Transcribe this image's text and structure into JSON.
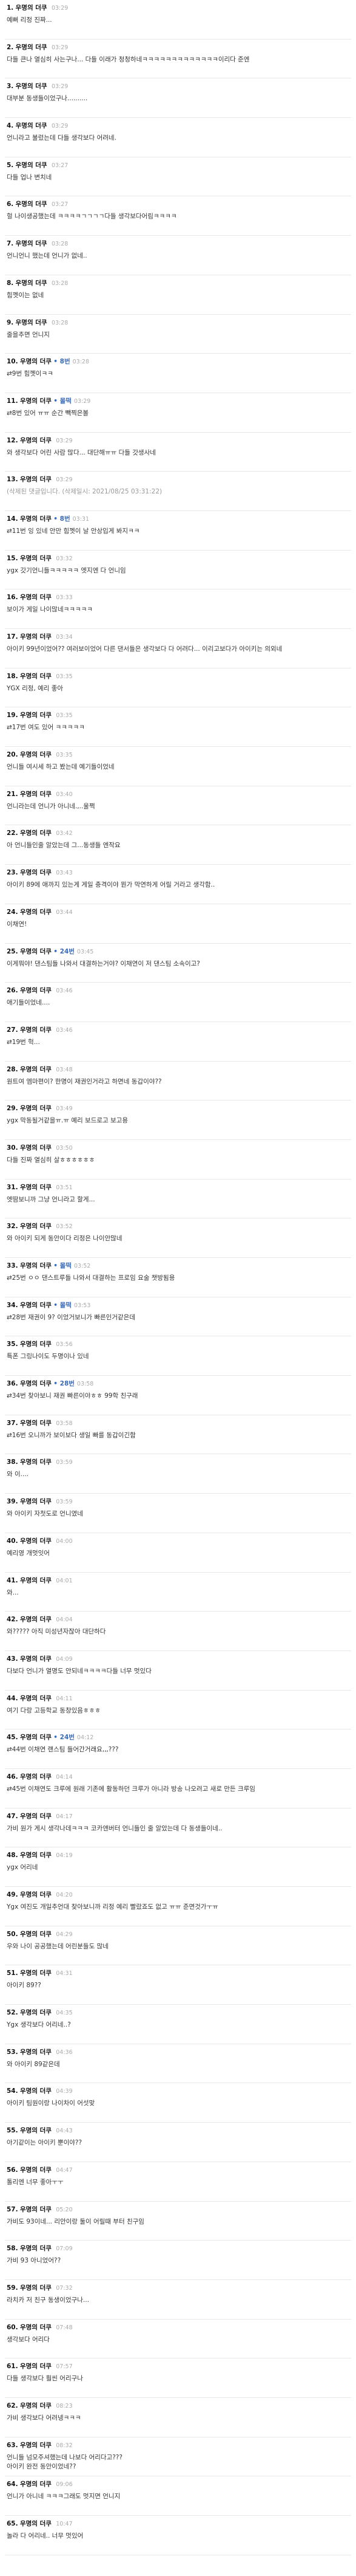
{
  "comments": [
    {
      "num": "1.",
      "nick": "우명의 더쿠",
      "mark": "",
      "time": "03:29",
      "ref": "",
      "text": "예뻐 리정 진짜..."
    },
    {
      "num": "2.",
      "nick": "우명의 더쿠",
      "mark": "",
      "time": "03:29",
      "ref": "",
      "text": "다들 큰나 열심히 사는구나... 다들 이래가 청청하네ㅋㅋㅋㅋㅋㅋㅋㅋㅋㅋㅋㅋㅋ이리다 준엔"
    },
    {
      "num": "3.",
      "nick": "우명의 더쿠",
      "mark": "",
      "time": "03:29",
      "ref": "",
      "text": "대부분 동생들이었구나.........."
    },
    {
      "num": "4.",
      "nick": "우명의 더쿠",
      "mark": "",
      "time": "03:29",
      "ref": "",
      "text": "언니라고 불렀는데 다들 생각보다 어려네."
    },
    {
      "num": "5.",
      "nick": "우명의 더쿠",
      "mark": "",
      "time": "03:27",
      "ref": "",
      "text": "다들 업나 변치네"
    },
    {
      "num": "6.",
      "nick": "우명의 더쿠",
      "mark": "",
      "time": "03:27",
      "ref": "",
      "text": "헐 나이생공했는데 ㅋㅋㅋㅋㄱㄱㄱㄱ다들 생각보다어림ㅋㅋㅋㅋ"
    },
    {
      "num": "7.",
      "nick": "우명의 더쿠",
      "mark": "",
      "time": "03:28",
      "ref": "",
      "text": "언니언니 했는데 언니가 없네.."
    },
    {
      "num": "8.",
      "nick": "우명의 더쿠",
      "mark": "",
      "time": "03:28",
      "ref": "",
      "text": "힘껫이는 없네"
    },
    {
      "num": "9.",
      "nick": "우명의 더쿠",
      "mark": "",
      "time": "03:28",
      "ref": "",
      "text": "줄을추면 언니지"
    },
    {
      "num": "10.",
      "nick": "우명의 더쿠",
      "mark": "• 8번",
      "time": "03:28",
      "ref": "",
      "text": "⇄9번 힘껫이ㅋㅋ"
    },
    {
      "num": "11.",
      "nick": "우명의 더쿠",
      "mark": "• 몰떡",
      "time": "03:29",
      "ref": "",
      "text": "⇄8번 있어 ㅠㅠ 순간 빽찍은볼"
    },
    {
      "num": "12.",
      "nick": "우명의 더쿠",
      "mark": "",
      "time": "03:29",
      "ref": "",
      "text": "와 생각보다 어린 사람 많다... 대단해ㅠㅠ 다들 갓생사네"
    },
    {
      "num": "13.",
      "nick": "우명의 더쿠",
      "mark": "",
      "time": "03:29",
      "ref": "",
      "text": "(삭제된 댓글입니다. (삭제일시: 2021/08/25 03:31:22)"
    },
    {
      "num": "14.",
      "nick": "우명의 더쿠",
      "mark": "• 8번",
      "time": "03:31",
      "ref": "",
      "text": "⇄11번 잉 있네 안만 힘껫이 날 안상입게 봐지ㅋㅋ"
    },
    {
      "num": "15.",
      "nick": "우명의 더쿠",
      "mark": "",
      "time": "03:32",
      "ref": "",
      "text": "ygx 갓기언니들ㅋㅋㅋㅋㅋ 엣지엔 다 언니임"
    },
    {
      "num": "16.",
      "nick": "우명의 더쿠",
      "mark": "",
      "time": "03:33",
      "ref": "",
      "text": "보이가 게일 나이많네ㅋㅋㅋㅋㅋ"
    },
    {
      "num": "17.",
      "nick": "우명의 더쿠",
      "mark": "",
      "time": "03:34",
      "ref": "",
      "text": "아이키 99년이었어?? 여러보이었어 다른 댄서들은 생각보다 다 어려다... 이리고보다가 아이키는 의외네"
    },
    {
      "num": "18.",
      "nick": "우명의 더쿠",
      "mark": "",
      "time": "03:35",
      "ref": "",
      "text": "YGX 리정, 예리 좋아"
    },
    {
      "num": "19.",
      "nick": "우명의 더쿠",
      "mark": "",
      "time": "03:35",
      "ref": "",
      "text": "⇄17번 여도 있어 ㅋㅋㅋㅋㅋ"
    },
    {
      "num": "20.",
      "nick": "우명의 더쿠",
      "mark": "",
      "time": "03:35",
      "ref": "",
      "text": "언니들 여시세 하고 봤는데 예기들이었네"
    },
    {
      "num": "21.",
      "nick": "우명의 더쿠",
      "mark": "",
      "time": "03:40",
      "ref": "",
      "text": "언니라는데 언니가 아니네.,..울쩍"
    },
    {
      "num": "22.",
      "nick": "우명의 더쿠",
      "mark": "",
      "time": "03:42",
      "ref": "",
      "text": "아 언니들인줄 알았는데 그...동생들 엔작요"
    },
    {
      "num": "23.",
      "nick": "우명의 더쿠",
      "mark": "",
      "time": "03:43",
      "ref": "",
      "text": "아이키 89에 애까지 있는게 게일 충격이야 뭔가 막연하게 어릴 거라고 생각함.."
    },
    {
      "num": "24.",
      "nick": "우명의 더쿠",
      "mark": "",
      "time": "03:44",
      "ref": "",
      "text": "이채연!"
    },
    {
      "num": "25.",
      "nick": "우명의 더쿠",
      "mark": "• 24번",
      "time": "03:45",
      "ref": "",
      "text": "이게뭐야! 댄스팀들 나와서 대결하는거야? 이채연이 저 댄스팀 소속이고?"
    },
    {
      "num": "26.",
      "nick": "우명의 더쿠",
      "mark": "",
      "time": "03:46",
      "ref": "",
      "text": "애기들이었네...."
    },
    {
      "num": "27.",
      "nick": "우명의 더쿠",
      "mark": "",
      "time": "03:46",
      "ref": "",
      "text": "⇄19번 헉..."
    },
    {
      "num": "28.",
      "nick": "우명의 더쿠",
      "mark": "",
      "time": "03:48",
      "ref": "",
      "text": "원트여 엠마편이? 한명이 재권인거라고 하면네 동갑이야??"
    },
    {
      "num": "29.",
      "nick": "우명의 더쿠",
      "mark": "",
      "time": "03:49",
      "ref": "",
      "text": "ygx 막동될거같을ㅠ.ㅠ 예리 보드로고 보고용"
    },
    {
      "num": "30.",
      "nick": "우명의 더쿠",
      "mark": "",
      "time": "03:50",
      "ref": "",
      "text": "다들 진짜 열심히 살ㅎㅎㅎㅎㅎㅎ"
    },
    {
      "num": "31.",
      "nick": "우명의 더쿠",
      "mark": "",
      "time": "03:51",
      "ref": "",
      "text": "엣땀보니까 그냥 언니라고 할게..."
    },
    {
      "num": "32.",
      "nick": "우명의 더쿠",
      "mark": "",
      "time": "03:52",
      "ref": "",
      "text": "와 아이키 되게 동안이다 리정은 나이안많네"
    },
    {
      "num": "33.",
      "nick": "우명의 더쿠",
      "mark": "• 몰떡",
      "time": "03:52",
      "ref": "",
      "text": "⇄25번 ㅇㅇ 댄스트루들 나와서 대결하는 프로임 요술 챗방됨용"
    },
    {
      "num": "34.",
      "nick": "우명의 더쿠",
      "mark": "• 몰떡",
      "time": "03:53",
      "ref": "",
      "text": "⇄28번 재권이 9? 이었거보니가 빠른인거같은데"
    },
    {
      "num": "35.",
      "nick": "우명의 더쿠",
      "mark": "",
      "time": "03:56",
      "ref": "",
      "text": "특폰 그링나이도 두명이나 있네"
    },
    {
      "num": "36.",
      "nick": "우명의 더쿠",
      "mark": "• 28번",
      "time": "03:58",
      "ref": "",
      "text": "⇄34번 찾아보니 재권 빠른이야ㅎㅎ 99학 친구래"
    },
    {
      "num": "37.",
      "nick": "우명의 더쿠",
      "mark": "",
      "time": "03:58",
      "ref": "",
      "text": "⇄16번 오니까가 보이보다 생일 빠를 동갑이긴함"
    },
    {
      "num": "38.",
      "nick": "우명의 더쿠",
      "mark": "",
      "time": "03:59",
      "ref": "",
      "text": "와 이...."
    },
    {
      "num": "39.",
      "nick": "우명의 더쿠",
      "mark": "",
      "time": "03:59",
      "ref": "",
      "text": "와 아이키 자첫도로 언니였네"
    },
    {
      "num": "40.",
      "nick": "우명의 더쿠",
      "mark": "",
      "time": "04:00",
      "ref": "",
      "text": "예리영 개멋잇어"
    },
    {
      "num": "41.",
      "nick": "우명의 더쿠",
      "mark": "",
      "time": "04:01",
      "ref": "",
      "text": "와..."
    },
    {
      "num": "42.",
      "nick": "우명의 더쿠",
      "mark": "",
      "time": "04:04",
      "ref": "",
      "text": "와????? 아직 미성년자잖아 대단하다"
    },
    {
      "num": "43.",
      "nick": "우명의 더쿠",
      "mark": "",
      "time": "04:09",
      "ref": "",
      "text": "다보다 언니가 열명도 안되네ㅋㅋㅋㅋ다들 너무 멋있다"
    },
    {
      "num": "44.",
      "nick": "우명의 더쿠",
      "mark": "",
      "time": "04:11",
      "ref": "",
      "text": "여기 다랑 고등학교 동창있음ㅎㅎㅎ"
    },
    {
      "num": "45.",
      "nick": "우명의 더쿠",
      "mark": "• 24번",
      "time": "04:12",
      "ref": "",
      "text": "⇄44번 이채연 랜스팀 들어간거래요,,,???"
    },
    {
      "num": "46.",
      "nick": "우명의 더쿠",
      "mark": "",
      "time": "04:14",
      "ref": "",
      "text": "⇄45번 이채연도 크루에 원래 기존에 활동하던 크루가 아니라 방송 나오려고 새로 만든 크루임"
    },
    {
      "num": "47.",
      "nick": "우명의 더쿠",
      "mark": "",
      "time": "04:17",
      "ref": "",
      "text": "가비 원가 게시 생각나데ㅋㅋㅋ 코카앤버터 언니들인 줄 알았는데 다 동생들이네.."
    },
    {
      "num": "48.",
      "nick": "우명의 더쿠",
      "mark": "",
      "time": "04:19",
      "ref": "",
      "text": "ygx 어리네"
    },
    {
      "num": "49.",
      "nick": "우명의 더쿠",
      "mark": "",
      "time": "04:20",
      "ref": "",
      "text": "Ygx 여진도 개일추언대 찾아보니까 리정 예리 빨랐죠도 없고 ㅠㅠ 준면것가ㅜㅠ"
    },
    {
      "num": "50.",
      "nick": "우명의 더쿠",
      "mark": "",
      "time": "04:29",
      "ref": "",
      "text": "우와 나이 공공했는데 어린분들도 많네"
    },
    {
      "num": "51.",
      "nick": "우명의 더쿠",
      "mark": "",
      "time": "04:31",
      "ref": "",
      "text": "아이키 89??"
    },
    {
      "num": "52.",
      "nick": "우명의 더쿠",
      "mark": "",
      "time": "04:35",
      "ref": "",
      "text": "Ygx 생각보다 어리네..?"
    },
    {
      "num": "53.",
      "nick": "우명의 더쿠",
      "mark": "",
      "time": "04:36",
      "ref": "",
      "text": "와 아이키 89같은데"
    },
    {
      "num": "54.",
      "nick": "우명의 더쿠",
      "mark": "",
      "time": "04:39",
      "ref": "",
      "text": "아이키 팀원이랑 나이차이 어섯맞"
    },
    {
      "num": "55.",
      "nick": "우명의 더쿠",
      "mark": "",
      "time": "04:43",
      "ref": "",
      "text": "아기같이는 아이키 뿐이야??"
    },
    {
      "num": "56.",
      "nick": "우명의 더쿠",
      "mark": "",
      "time": "04:47",
      "ref": "",
      "text": "톨리엔 너무 좋아ㅜㅜ"
    },
    {
      "num": "57.",
      "nick": "우명의 더쿠",
      "mark": "",
      "time": "05:20",
      "ref": "",
      "text": "가비도 93이네... 리안이랑 둘이 어릴때 부터 친구임"
    },
    {
      "num": "58.",
      "nick": "우명의 더쿠",
      "mark": "",
      "time": "07:09",
      "ref": "",
      "text": "가비 93 아니었어??"
    },
    {
      "num": "59.",
      "nick": "우명의 더쿠",
      "mark": "",
      "time": "07:32",
      "ref": "",
      "text": "라치카 저 친구 동생이었구나..."
    },
    {
      "num": "60.",
      "nick": "우명의 더쿠",
      "mark": "",
      "time": "07:48",
      "ref": "",
      "text": "생각보다 어리다"
    },
    {
      "num": "61.",
      "nick": "우명의 더쿠",
      "mark": "",
      "time": "07:57",
      "ref": "",
      "text": "다들 생각보다 훨씬 어리구나"
    },
    {
      "num": "62.",
      "nick": "우명의 더쿠",
      "mark": "",
      "time": "08:23",
      "ref": "",
      "text": "가비 생각보다 어려넹ㅋㅋㅋ"
    },
    {
      "num": "63.",
      "nick": "우명의 더쿠",
      "mark": "",
      "time": "08:32",
      "ref": "",
      "text": "언니들 넘모주셔했는데 나보다 어리다고???\n아이키 완전 동안이었네??"
    },
    {
      "num": "64.",
      "nick": "우명의 더쿠",
      "mark": "",
      "time": "09:06",
      "ref": "",
      "text": "언니가 아니네 ㅋㅋㅋ그래도 멋지면 언니지"
    },
    {
      "num": "65.",
      "nick": "우명의 더쿠",
      "mark": "",
      "time": "10:47",
      "ref": "",
      "text": "놀라 다 어리네.. 너무 멋있어"
    }
  ]
}
